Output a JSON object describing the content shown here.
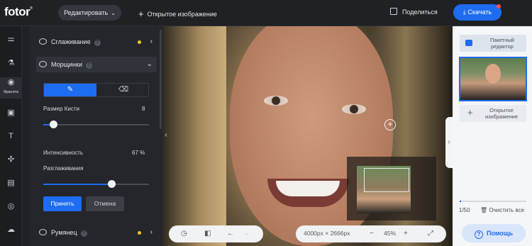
{
  "app": {
    "logo": "fotor",
    "logo_mark": "®"
  },
  "topbar": {
    "edit_dropdown": "Редактировать",
    "open_image": "Открытое изображение",
    "share": "Поделиться",
    "download": "Скачать"
  },
  "rail": {
    "active_label": "Красота"
  },
  "panel": {
    "smoothing": "Сглаживание",
    "wrinkles": "Морщинки",
    "brush_size_label": "Размер Кисти",
    "brush_size_value": "8",
    "brush_size_level": 0.1,
    "intensity_label": "Интенсивность",
    "intensity_value": "67 %",
    "smoothing_label": "Разглаживания",
    "smoothing_level": 0.65,
    "accept": "Принять",
    "cancel": "Отмена",
    "blush": "Румянец",
    "help_mark": "?"
  },
  "canvas": {
    "dimensions": "4000px × 2666px",
    "zoom": "45%"
  },
  "right": {
    "batch_editor": "Пакетный редактор",
    "open_image": "Открытое изображение",
    "count": "1/50",
    "clear_all": "Очистить все",
    "help": "Помощь",
    "progress": 0.02
  },
  "colors": {
    "accent": "#1e6cf0",
    "dot": "#f5c518"
  }
}
